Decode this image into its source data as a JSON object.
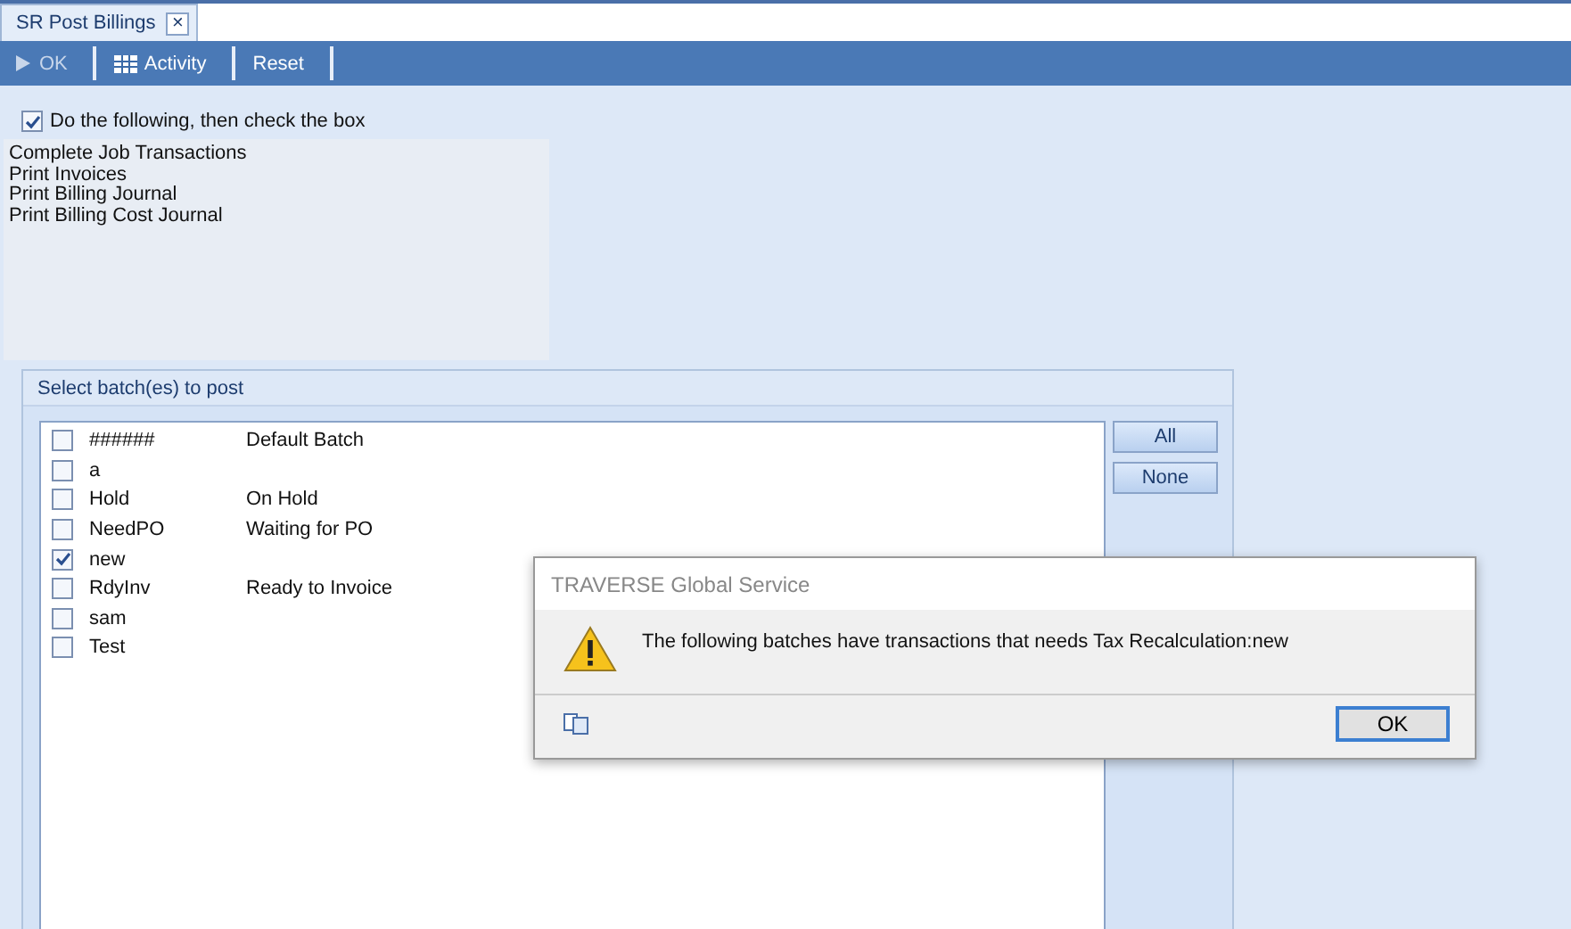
{
  "tab": {
    "label": "SR Post Billings",
    "close": "×"
  },
  "toolbar": [
    {
      "label": "OK",
      "kind": "play",
      "disabled": true
    },
    {
      "label": "Activity",
      "kind": "grid",
      "disabled": false
    },
    {
      "label": "Reset",
      "kind": "plain",
      "disabled": false
    }
  ],
  "instructions": {
    "checkbox": {
      "label": "Do the following, then check the box",
      "checked": true
    },
    "steps": [
      "Complete Job Transactions",
      "Print Invoices",
      "Print Billing Journal",
      "Print Billing Cost Journal"
    ]
  },
  "batches": {
    "title": "Select batch(es) to post",
    "rows": [
      {
        "id": "######",
        "description": "Default Batch",
        "checked": false
      },
      {
        "id": "a",
        "description": "",
        "checked": false
      },
      {
        "id": "Hold",
        "description": "On Hold",
        "checked": false
      },
      {
        "id": "NeedPO",
        "description": "Waiting for PO",
        "checked": false
      },
      {
        "id": "new",
        "description": "",
        "checked": true
      },
      {
        "id": "RdyInv",
        "description": "Ready to Invoice",
        "checked": false
      },
      {
        "id": "sam",
        "description": "",
        "checked": false
      },
      {
        "id": "Test",
        "description": "",
        "checked": false
      }
    ],
    "buttons": [
      "All",
      "None"
    ]
  },
  "dialog": {
    "title": "TRAVERSE Global Service",
    "message": "The following batches have transactions that needs Tax Recalculation:new",
    "button": "OK"
  }
}
